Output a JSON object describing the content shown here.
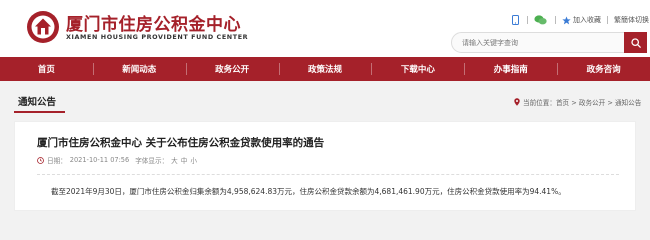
{
  "header": {
    "title_cn": "厦门市住房公积金中心",
    "title_en": "XIAMEN HOUSING PROVIDENT FUND CENTER",
    "top_links": {
      "favorite": "加入收藏",
      "language": "繁簡体切换"
    },
    "search": {
      "placeholder": "请输入关键字查询"
    }
  },
  "nav": {
    "items": [
      "首页",
      "新闻动态",
      "政务公开",
      "政策法规",
      "下载中心",
      "办事指南",
      "政务咨询"
    ]
  },
  "section": {
    "title": "通知公告",
    "breadcrumb": "当前位置：首页 > 政务公开 > 通知公告"
  },
  "article": {
    "title": "厦门市住房公积金中心 关于公布住房公积金贷款使用率的通告",
    "date_label": "日期：",
    "date": "2021-10-11 07:56",
    "font_size_label": "字体显示：",
    "font_large": "大",
    "font_medium": "中",
    "font_small": "小",
    "body": "截至2021年9月30日，厦门市住房公积金归集余额为4,958,624.83万元，住房公积金贷款余额为4,681,461.90万元，住房公积金贷款使用率为94.41%。"
  },
  "colors": {
    "brand": "#a5212a"
  }
}
